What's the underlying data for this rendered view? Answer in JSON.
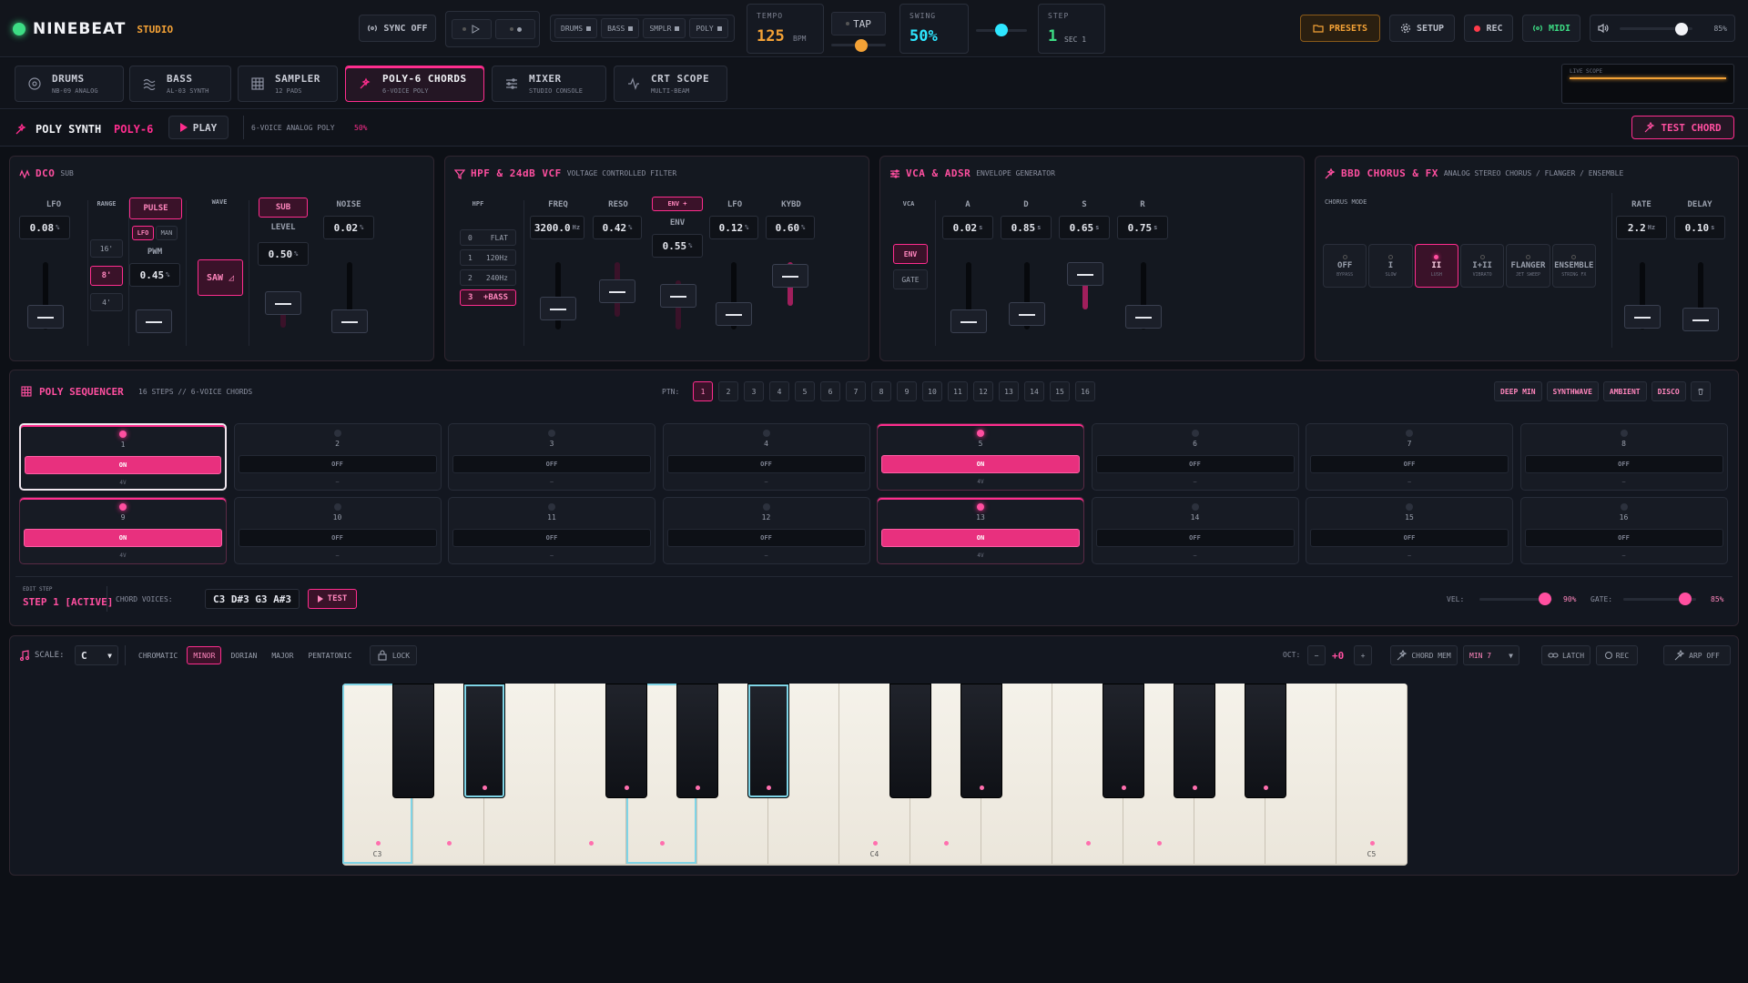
{
  "app": {
    "name": "NINEBEAT",
    "studio": "STUDIO"
  },
  "topbar": {
    "sync": "SYNC OFF",
    "modules": [
      "DRUMS",
      "BASS",
      "SMPLR",
      "POLY"
    ],
    "tempo_label": "TEMPO",
    "tempo_value": "125",
    "tempo_unit": "BPM",
    "tap": "TAP",
    "swing_label": "SWING",
    "swing_value": "50%",
    "step_label": "STEP",
    "step_value": "1",
    "step_sec": "SEC 1",
    "presets": "PRESETS",
    "setup": "SETUP",
    "rec": "REC",
    "midi": "MIDI",
    "volume": "85%",
    "volume_level": 0.85,
    "swing_level": 0.5,
    "tap_level": 0.55
  },
  "tabs": [
    {
      "label": "DRUMS",
      "sub": "NB-09 ANALOG",
      "icon": "target-icon"
    },
    {
      "label": "BASS",
      "sub": "AL-03 SYNTH",
      "icon": "wave-icon"
    },
    {
      "label": "SAMPLER",
      "sub": "12 PADS",
      "icon": "grid-icon"
    },
    {
      "label": "POLY-6 CHORDS",
      "sub": "6-VOICE POLY",
      "icon": "sparkle-icon"
    },
    {
      "label": "MIXER",
      "sub": "STUDIO CONSOLE",
      "icon": "sliders-icon"
    },
    {
      "label": "CRT SCOPE",
      "sub": "MULTI-BEAM",
      "icon": "pulse-icon"
    }
  ],
  "scope": {
    "label": "LIVE SCOPE"
  },
  "synth": {
    "title": "POLY SYNTH",
    "model": "POLY-6",
    "play": "PLAY",
    "voice_info": "6-VOICE ANALOG POLY",
    "voice_pct": "50%",
    "test_chord": "TEST CHORD"
  },
  "dco": {
    "title": "DCO",
    "sub": "SUB",
    "lfo_label": "LFO",
    "lfo_value": "0.08",
    "lfo_unit": "%",
    "range_label": "RANGE",
    "ranges": [
      "16'",
      "8'",
      "4'"
    ],
    "pulse": "PULSE",
    "lfo_btn": "LFO",
    "man_btn": "MAN",
    "pwm_label": "PWM",
    "pwm_value": "0.45",
    "pwm_unit": "%",
    "wave_label": "WAVE",
    "saw": "SAW ◿",
    "level_label": "LEVEL",
    "level_value": "0.50",
    "level_unit": "%",
    "noise_label": "NOISE",
    "noise_value": "0.02",
    "noise_unit": "%"
  },
  "vcf": {
    "title": "HPF & 24dB VCF",
    "sub": "VOLTAGE CONTROLLED FILTER",
    "hpf_label": "HPF",
    "hpf_opts": [
      {
        "n": "0",
        "t": "FLAT"
      },
      {
        "n": "1",
        "t": "120Hz"
      },
      {
        "n": "2",
        "t": "240Hz"
      },
      {
        "n": "3",
        "t": "+BASS"
      }
    ],
    "freq_label": "FREQ",
    "freq_value": "3200.0",
    "freq_unit": "Hz",
    "reso_label": "RESO",
    "reso_value": "0.42",
    "reso_unit": "%",
    "env_btn": "ENV +",
    "env_label": "ENV",
    "env_value": "0.55",
    "env_unit": "%",
    "lfo_label": "LFO",
    "lfo_value": "0.12",
    "lfo_unit": "%",
    "kybd_label": "KYBD",
    "kybd_value": "0.60",
    "kybd_unit": "%"
  },
  "vca": {
    "title": "VCA & ADSR",
    "sub": "ENVELOPE GENERATOR",
    "vca_label": "VCA",
    "env": "ENV",
    "gate": "GATE",
    "a_label": "A",
    "a_value": "0.02",
    "d_label": "D",
    "d_value": "0.85",
    "s_label": "S",
    "s_value": "0.65",
    "r_label": "R",
    "r_value": "0.75",
    "unit": "s"
  },
  "chorus": {
    "title": "BBD CHORUS & FX",
    "sub": "ANALOG STEREO CHORUS / FLANGER / ENSEMBLE",
    "mode_label": "CHORUS MODE",
    "modes": [
      {
        "t": "OFF",
        "s": "BYPASS"
      },
      {
        "t": "I",
        "s": "SLOW"
      },
      {
        "t": "II",
        "s": "LUSH"
      },
      {
        "t": "I+II",
        "s": "VIBRATO"
      },
      {
        "t": "FLANGER",
        "s": "JET SWEEP"
      },
      {
        "t": "ENSEMBLE",
        "s": "STRING FX"
      }
    ],
    "rate_label": "RATE",
    "rate_value": "2.2",
    "rate_unit": "Hz",
    "delay_label": "DELAY",
    "delay_value": "0.10",
    "delay_unit": "s"
  },
  "sequencer": {
    "title": "POLY SEQUENCER",
    "sub": "16 STEPS // 6-VOICE CHORDS",
    "ptn_label": "PTN:",
    "patterns": [
      "1",
      "2",
      "3",
      "4",
      "5",
      "6",
      "7",
      "8",
      "9",
      "10",
      "11",
      "12",
      "13",
      "14",
      "15",
      "16"
    ],
    "presets": [
      "DEEP MIN",
      "SYNTHWAVE",
      "AMBIENT",
      "DISCO"
    ],
    "steps": [
      {
        "n": "1",
        "s": "ON",
        "v": "4V"
      },
      {
        "n": "2",
        "s": "OFF",
        "v": "—"
      },
      {
        "n": "3",
        "s": "OFF",
        "v": "—"
      },
      {
        "n": "4",
        "s": "OFF",
        "v": "—"
      },
      {
        "n": "5",
        "s": "ON",
        "v": "4V"
      },
      {
        "n": "6",
        "s": "OFF",
        "v": "—"
      },
      {
        "n": "7",
        "s": "OFF",
        "v": "—"
      },
      {
        "n": "8",
        "s": "OFF",
        "v": "—"
      },
      {
        "n": "9",
        "s": "ON",
        "v": "4V"
      },
      {
        "n": "10",
        "s": "OFF",
        "v": "—"
      },
      {
        "n": "11",
        "s": "OFF",
        "v": "—"
      },
      {
        "n": "12",
        "s": "OFF",
        "v": "—"
      },
      {
        "n": "13",
        "s": "ON",
        "v": "4V"
      },
      {
        "n": "14",
        "s": "OFF",
        "v": "—"
      },
      {
        "n": "15",
        "s": "OFF",
        "v": "—"
      },
      {
        "n": "16",
        "s": "OFF",
        "v": "—"
      }
    ],
    "edit_label": "EDIT STEP",
    "edit_value": "STEP 1 [ACTIVE]",
    "chord_label": "CHORD VOICES:",
    "chord_value": "C3 D#3 G3 A#3",
    "test": "TEST",
    "vel_label": "VEL:",
    "vel_value": "90%",
    "vel_level": 0.9,
    "gate_label": "GATE:",
    "gate_value": "85%",
    "gate_level": 0.85
  },
  "keyboard": {
    "scale_label": "SCALE:",
    "root": "C",
    "scales": [
      "CHROMATIC",
      "MINOR",
      "DORIAN",
      "MAJOR",
      "PENTATONIC"
    ],
    "lock": "LOCK",
    "oct_label": "OCT:",
    "oct_value": "+0",
    "chord_mem": "CHORD MEM",
    "chord_type": "MIN 7",
    "latch": "LATCH",
    "rec": "REC",
    "arp": "ARP OFF",
    "labels": {
      "c3": "C3",
      "c4": "C4",
      "c5": "C5"
    }
  },
  "colors": {
    "accent": "#ff2d8e",
    "orange": "#f4a236",
    "cyan": "#2ee6ff",
    "green": "#3ddc84"
  }
}
